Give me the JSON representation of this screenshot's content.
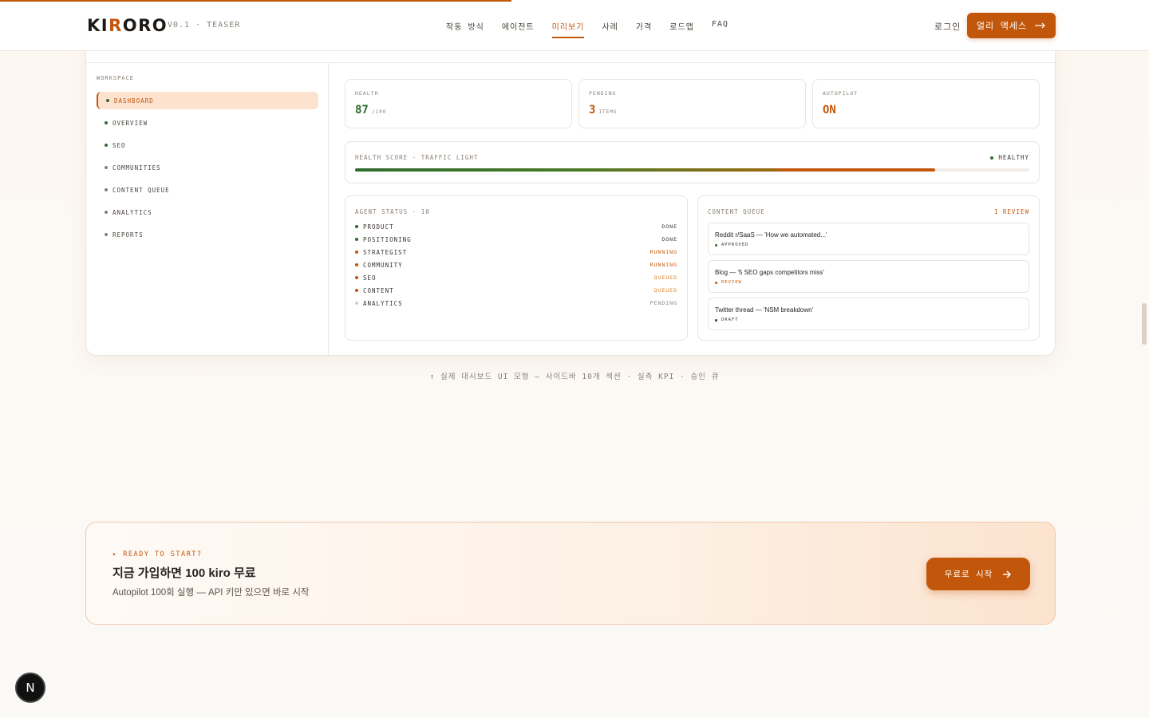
{
  "header": {
    "logo_prefix": "KI",
    "logo_mark": "R",
    "logo_suffix": "ORO",
    "version": "V0.1 · TEASER",
    "nav": [
      "작동 방식",
      "에이전트",
      "미리보기",
      "사례",
      "가격",
      "로드맵",
      "FAQ"
    ],
    "active_nav": "미리보기",
    "login": "로그인",
    "cta": "얼리 액세스",
    "cta_icon": "arrow-right-icon"
  },
  "sidebar": {
    "label": "WORKSPACE",
    "items": [
      {
        "label": "DASHBOARD",
        "active": true
      },
      {
        "label": "OVERVIEW"
      },
      {
        "label": "SEO"
      },
      {
        "label": "COMMUNITIES"
      },
      {
        "label": "CONTENT QUEUE"
      },
      {
        "label": "ANALYTICS"
      },
      {
        "label": "REPORTS"
      }
    ]
  },
  "stats": [
    {
      "label": "HEALTH",
      "value": "87",
      "unit": "/100",
      "color": "#2f6b2f"
    },
    {
      "label": "PENDING",
      "value": "3",
      "unit": "ITEMS",
      "color": "#c2570c"
    },
    {
      "label": "AUTOPILOT",
      "value": "ON",
      "unit": "",
      "color": "#c2570c"
    }
  ],
  "health_score": {
    "label": "HEALTH SCORE · TRAFFIC LIGHT",
    "status": "HEALTHY",
    "value_fraction": 0.86
  },
  "agent_status": {
    "label": "AGENT STATUS · 10",
    "agents": [
      {
        "name": "PRODUCT",
        "status": "DONE",
        "color": "#2f6b2f",
        "status_color": "#3a3330"
      },
      {
        "name": "POSITIONING",
        "status": "DONE",
        "color": "#2f6b2f",
        "status_color": "#3a3330"
      },
      {
        "name": "STRATEGIST",
        "status": "RUNNING",
        "color": "#c2570c",
        "status_color": "#c2570c"
      },
      {
        "name": "COMMUNITY",
        "status": "RUNNING",
        "color": "#c2570c",
        "status_color": "#c2570c"
      },
      {
        "name": "SEO",
        "status": "QUEUED",
        "color": "#c2570c",
        "status_color": "#d9822b"
      },
      {
        "name": "CONTENT",
        "status": "QUEUED",
        "color": "#c2570c",
        "status_color": "#d9822b"
      },
      {
        "name": "ANALYTICS",
        "status": "PENDING",
        "color": "#d3ccc5",
        "status_color": "#8a7f76"
      }
    ]
  },
  "content_queue": {
    "label": "CONTENT QUEUE",
    "badge": "1 REVIEW",
    "items": [
      {
        "title": "Reddit r/SaaS — 'How we automated...'",
        "status": "APPROVED",
        "color": "#2f6b2f",
        "status_color": "#3a3330"
      },
      {
        "title": "Blog — '5 SEO gaps competitors miss'",
        "status": "REVIEW",
        "color": "#c2570c",
        "status_color": "#c2570c"
      },
      {
        "title": "Twitter thread — 'NSM breakdown'",
        "status": "DRAFT",
        "color": "#3a3330",
        "status_color": "#3a3330"
      }
    ]
  },
  "caption": "↑ 실제 대시보드 UI 모형 — 사이드바 10개 섹션 · 실측 KPI · 승인 큐",
  "cta": {
    "eyebrow": "▸ READY TO START?",
    "title": "지금 가입하면 100 kiro 무료",
    "subtitle": "Autopilot 100회 실행 — API 키만 있으면 바로 시작",
    "button": "무료로 시작",
    "button_icon": "arrow-right-icon"
  },
  "dev_badge": "N",
  "colors": {
    "accent": "#c2570c",
    "success": "#2f6b2f"
  }
}
